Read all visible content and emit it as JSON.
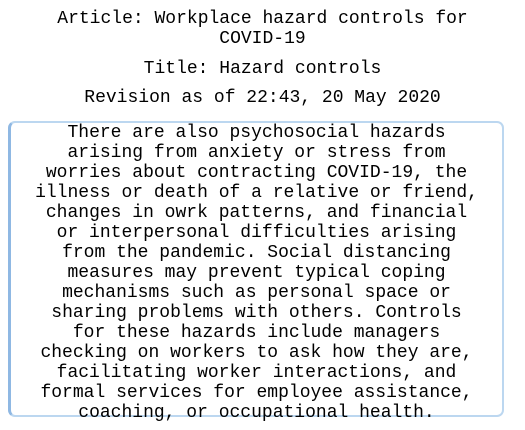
{
  "header": {
    "article": "Article: Workplace hazard controls for COVID-19",
    "title": "Title: Hazard controls",
    "revision": "Revision as of 22:43, 20 May 2020"
  },
  "content": {
    "text": "There are also psychosocial hazards\narising from anxiety or stress from\nworries about contracting COVID-19, the\nillness or death of a relative or friend,\nchanges in owrk patterns, and financial\nor interpersonal difficulties arising\nfrom the pandemic. Social distancing\nmeasures may prevent typical coping\nmechanisms such as personal space or\nsharing problems with others. Controls\nfor these hazards include managers\nchecking on workers to ask how they are,\nfacilitating worker interactions, and\nformal services for employee assistance,\ncoaching, or occupational health."
  },
  "colors": {
    "box_border": "#bcd7f0",
    "box_border_accent": "#8fb8e3"
  }
}
